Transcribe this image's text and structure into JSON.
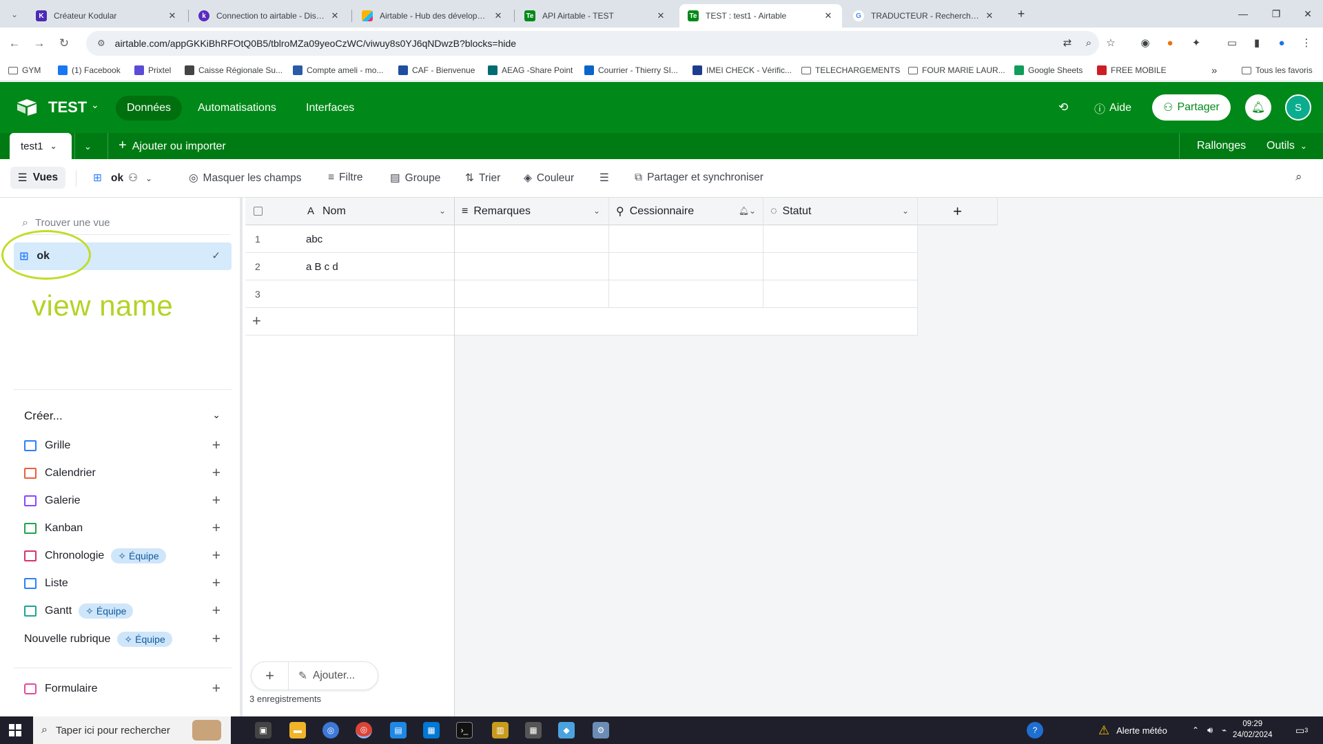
{
  "browser": {
    "tabs": [
      {
        "title": "Créateur Kodular",
        "fav": "K",
        "color": "#4b2bb5"
      },
      {
        "title": "Connection to airtable - Discuss",
        "fav": "k",
        "color": "#5a2cc0"
      },
      {
        "title": "Airtable - Hub des développeurs",
        "fav": "",
        "color": "#fcb400"
      },
      {
        "title": "API Airtable - TEST",
        "fav": "Te",
        "color": "#008918"
      },
      {
        "title": "TEST : test1 - Airtable",
        "fav": "Te",
        "color": "#008918"
      },
      {
        "title": "TRADUCTEUR - Recherche Google",
        "fav": "G",
        "color": "#ffffff"
      }
    ],
    "url": "airtable.com/appGKKiBhRFOtQ0B5/tblroMZa09yeoCzWC/viwuy8s0YJ6qNDwzB?blocks=hide",
    "bookmarks": [
      {
        "label": "GYM",
        "type": "folder"
      },
      {
        "label": "(1) Facebook",
        "type": "icon",
        "color": "#1877f2"
      },
      {
        "label": "Prixtel",
        "type": "icon",
        "color": "#5b4bd8"
      },
      {
        "label": "Caisse Régionale Su...",
        "type": "icon",
        "color": "#444"
      },
      {
        "label": "Compte ameli - mo...",
        "type": "icon",
        "color": "#2a5aa8"
      },
      {
        "label": "CAF - Bienvenue",
        "type": "icon",
        "color": "#1d4f9e"
      },
      {
        "label": "AEAG -Share Point",
        "type": "icon",
        "color": "#036c70"
      },
      {
        "label": "Courrier - Thierry SI...",
        "type": "icon",
        "color": "#0a64c9"
      },
      {
        "label": "IMEI CHECK - Vérific...",
        "type": "icon",
        "color": "#1e3c8f"
      },
      {
        "label": "TELECHARGEMENTS",
        "type": "folder"
      },
      {
        "label": "FOUR MARIE LAUR...",
        "type": "folder"
      },
      {
        "label": "Google Sheets",
        "type": "icon",
        "color": "#0f9d58"
      },
      {
        "label": "FREE MOBILE",
        "type": "icon",
        "color": "#cd1e25"
      }
    ],
    "bookmarks_more": "»",
    "all_bookmarks": "Tous les favoris"
  },
  "app": {
    "base_name": "TEST",
    "nav": [
      "Données",
      "Automatisations",
      "Interfaces"
    ],
    "help": "Aide",
    "share": "Partager",
    "avatar": "S",
    "table_tab": "test1",
    "add_import": "Ajouter ou importer",
    "extensions": "Rallonges",
    "tools": "Outils"
  },
  "viewbar": {
    "views_btn": "Vues",
    "view_name": "ok",
    "hide_fields": "Masquer les champs",
    "filter": "Filtre",
    "group": "Groupe",
    "sort": "Trier",
    "color": "Couleur",
    "share_sync": "Partager et synchroniser"
  },
  "sidebar": {
    "find_placeholder": "Trouver une vue",
    "active_view": "ok",
    "annotation": "view name",
    "create_title": "Créer...",
    "create_items": [
      {
        "label": "Grille",
        "badge": "",
        "icon_color": "#2d7ff9"
      },
      {
        "label": "Calendrier",
        "badge": "",
        "icon_color": "#e8603c"
      },
      {
        "label": "Galerie",
        "badge": "",
        "icon_color": "#8b46ff"
      },
      {
        "label": "Kanban",
        "badge": "",
        "icon_color": "#20a34d"
      },
      {
        "label": "Chronologie",
        "badge": "Équipe",
        "icon_color": "#d7346f"
      },
      {
        "label": "Liste",
        "badge": "",
        "icon_color": "#2d7ff9"
      },
      {
        "label": "Gantt",
        "badge": "Équipe",
        "icon_color": "#20a38f"
      },
      {
        "label": "Nouvelle rubrique",
        "badge": "Équipe",
        "icon_color": ""
      }
    ],
    "form_item": {
      "label": "Formulaire",
      "icon_color": "#e04aa0"
    }
  },
  "grid": {
    "columns": [
      "Nom",
      "Remarques",
      "Cessionnaire",
      "Statut"
    ],
    "rows": [
      {
        "num": "1",
        "nom": "abc"
      },
      {
        "num": "2",
        "nom": "a B c d"
      },
      {
        "num": "3",
        "nom": ""
      }
    ],
    "add_label": "Ajouter...",
    "record_count": "3 enregistrements"
  },
  "taskbar": {
    "search_placeholder": "Taper ici pour rechercher",
    "weather": "Alerte météo",
    "time": "09:29",
    "date": "24/02/2024",
    "notif_count": "3"
  }
}
